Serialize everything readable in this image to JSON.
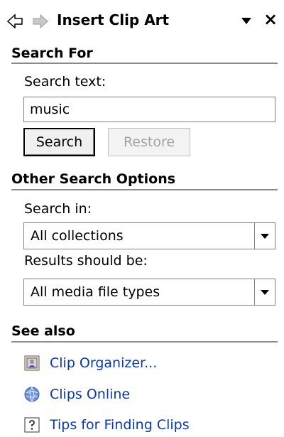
{
  "pane": {
    "title": "Insert Clip Art",
    "close_label": "×"
  },
  "search_for": {
    "heading": "Search For",
    "search_text_label": "Search text:",
    "search_value": "music",
    "search_button": "Search",
    "restore_button": "Restore"
  },
  "other_options": {
    "heading": "Other Search Options",
    "search_in_label": "Search in:",
    "search_in_value": "All collections",
    "results_label": "Results should be:",
    "results_value": "All media file types"
  },
  "see_also": {
    "heading": "See also",
    "links": [
      {
        "label": "Clip Organizer...",
        "icon": "clip-organizer-icon"
      },
      {
        "label": "Clips Online",
        "icon": "globe-icon"
      },
      {
        "label": "Tips for Finding Clips",
        "icon": "help-icon"
      }
    ]
  },
  "colors": {
    "link": "#0b3aa8",
    "rule": "#8b8b8b",
    "disabled_text": "#a3a3a3"
  }
}
